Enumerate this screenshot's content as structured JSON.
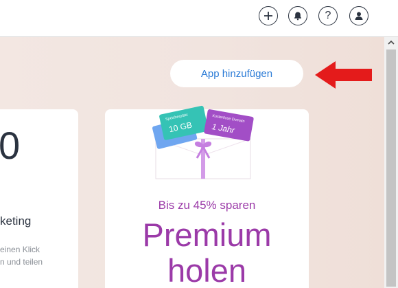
{
  "topbar": {
    "icons": [
      "plus-icon",
      "bell-icon",
      "help-icon",
      "profile-icon"
    ],
    "help_label": "?"
  },
  "main": {
    "add_app_label": "App hinzufügen",
    "left_card": {
      "big_number": "0",
      "title": "keting",
      "desc_line1": "einen Klick",
      "desc_line2": "n und teilen"
    },
    "premium_card": {
      "tag_storage_small": "Speicherplatz",
      "tag_storage_big": "10 GB",
      "tag_domain_small": "Kostenlose Domain",
      "tag_domain_big": "1 Jahr",
      "subtitle": "Bis zu 45% sparen",
      "title_line1": "Premium",
      "title_line2": "holen"
    }
  },
  "colors": {
    "accent_blue": "#2b7bd6",
    "premium_purple": "#9b3aa8",
    "arrow_red": "#e41b1b",
    "background": "#f1e4df"
  }
}
